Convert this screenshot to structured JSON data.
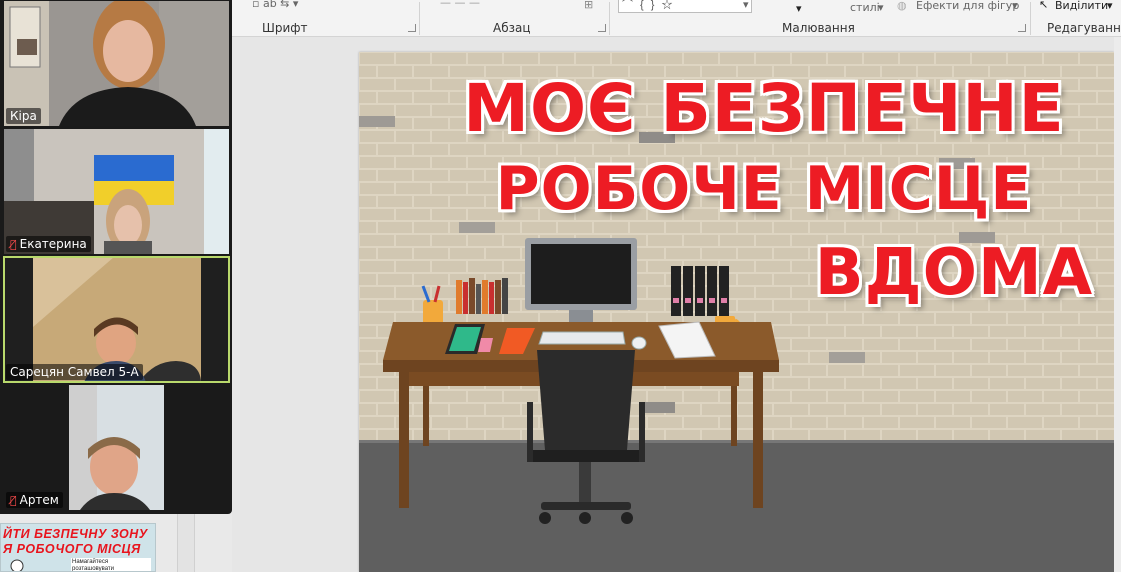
{
  "ribbon": {
    "groups": {
      "font": "Шрифт",
      "paragraph": "Абзац",
      "drawing": "Малювання",
      "editing": "Редагування"
    },
    "styles_label": "стилі",
    "shape_effects": "Ефекти для фігур",
    "select": "Виділити"
  },
  "video": {
    "participants": [
      {
        "name": "Кіра",
        "muted": false
      },
      {
        "name": "Екатерина",
        "muted": true
      },
      {
        "name": "Сарецян Самвел 5-А",
        "muted": false
      },
      {
        "name": "Артем",
        "muted": true
      }
    ]
  },
  "slide": {
    "title_lines": [
      "МОЄ БЕЗПЕЧНЕ",
      "РОБОЧЕ МІСЦЕ",
      "ВДОМА"
    ]
  },
  "thumbnail": {
    "line1": "ЙТИ БЕЗПЕЧНУ ЗОНУ",
    "line2": "Я РОБОЧОГО МІСЦЯ",
    "note": "Намагайтеся розташовувати"
  },
  "colors": {
    "title_red": "#ed1c24",
    "active_speaker": "#b9d96c",
    "brick": "#d5cbb6",
    "floor": "#5f5f5f"
  }
}
